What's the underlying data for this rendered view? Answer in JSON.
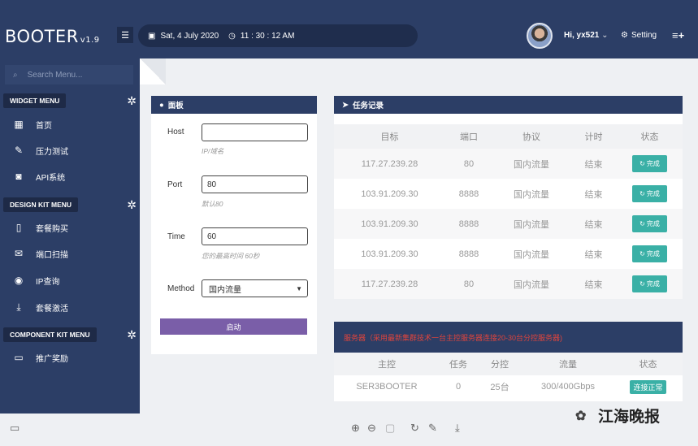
{
  "brand": {
    "name": "BOOTER",
    "version": "v1.9"
  },
  "header": {
    "menu_icon": "hamburger-icon",
    "date": "Sat, 4 July 2020",
    "time": "11 : 30 : 12 AM",
    "user_greeting": "Hi, yx521",
    "setting_label": "Setting"
  },
  "sidebar": {
    "search_placeholder": "Search Menu...",
    "sections": [
      {
        "title": "WIDGET MENU",
        "items": [
          {
            "label": "首页",
            "icon": "grid-icon"
          },
          {
            "label": "压力测试",
            "icon": "edit-icon"
          },
          {
            "label": "API系统",
            "icon": "camera-icon"
          }
        ]
      },
      {
        "title": "DESIGN KIT MENU",
        "items": [
          {
            "label": "套餐购买",
            "icon": "file-icon"
          },
          {
            "label": "端口扫描",
            "icon": "mail-icon"
          },
          {
            "label": "IP查询",
            "icon": "eye-icon"
          },
          {
            "label": "套餐激活",
            "icon": "download-icon"
          }
        ]
      },
      {
        "title": "COMPONENT KIT MENU",
        "items": [
          {
            "label": "推广奖励",
            "icon": "monitor-icon"
          }
        ]
      }
    ]
  },
  "panel": {
    "title": "面板",
    "host_label": "Host",
    "host_value": "",
    "host_hint": "IP/域名",
    "port_label": "Port",
    "port_value": "80",
    "port_hint": "默认80",
    "time_label": "Time",
    "time_value": "60",
    "time_hint": "您的最高时间 60秒",
    "method_label": "Method",
    "method_value": "国内流量",
    "start_label": "启动"
  },
  "tasks": {
    "title": "任务记录",
    "columns": [
      "目标",
      "端口",
      "协议",
      "计时",
      "状态"
    ],
    "rows": [
      {
        "target": "117.27.239.28",
        "port": "80",
        "protocol": "国内流量",
        "timer": "结束",
        "status": "完成"
      },
      {
        "target": "103.91.209.30",
        "port": "8888",
        "protocol": "国内流量",
        "timer": "结束",
        "status": "完成"
      },
      {
        "target": "103.91.209.30",
        "port": "8888",
        "protocol": "国内流量",
        "timer": "结束",
        "status": "完成"
      },
      {
        "target": "103.91.209.30",
        "port": "8888",
        "protocol": "国内流量",
        "timer": "结束",
        "status": "完成"
      },
      {
        "target": "117.27.239.28",
        "port": "80",
        "protocol": "国内流量",
        "timer": "结束",
        "status": "完成"
      }
    ]
  },
  "servers": {
    "title": "服务器（采用最新集群技术一台主控服务器连接20-30台分控服务器)",
    "columns": [
      "主控",
      "任务",
      "分控",
      "流量",
      "状态"
    ],
    "rows": [
      {
        "master": "SER3BOOTER",
        "tasks": "0",
        "slaves": "25台",
        "traffic": "300/400Gbps",
        "status": "连接正常"
      }
    ]
  },
  "watermark": "江海晚报",
  "colors": {
    "navy": "#2c3e66",
    "teal": "#3ab0a6",
    "purple": "#7a5ea8",
    "alert_red": "#e0443c"
  }
}
